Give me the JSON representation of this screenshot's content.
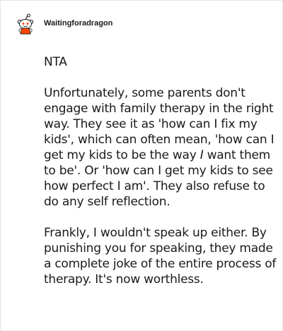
{
  "comment": {
    "username": "Waitingforadragon",
    "avatar_icon": "reddit-snoo-icon",
    "paragraphs": [
      "NTA",
      "Unfortunately, some parents don't engage with family therapy in the right way. They see it as 'how can I fix my kids', which can often mean, 'how can I get my kids to be the way I want them to be'. Or 'how can I get my kids to see how perfect I am'. They also refuse to do any self reflection.",
      "Frankly, I wouldn't speak up either. By punishing you for speaking, they made a complete joke of the entire process of therapy. It's now worthless."
    ]
  }
}
